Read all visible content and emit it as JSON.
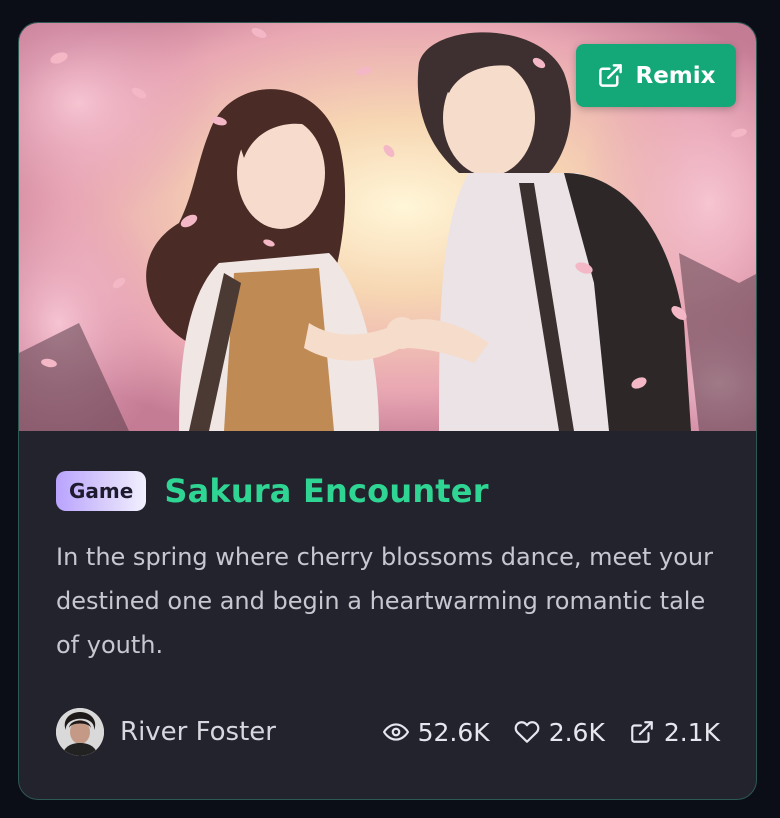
{
  "card": {
    "remix_label": "Remix",
    "tag": "Game",
    "title": "Sakura Encounter",
    "description": "In the spring where cherry blossoms dance, meet your destined one and begin a heartwarming romantic tale of youth.",
    "author": "River Foster",
    "stats": {
      "views": "52.6K",
      "likes": "2.6K",
      "remixes": "2.1K"
    }
  },
  "icons": {
    "remix": "external-link-icon",
    "views": "eye-icon",
    "likes": "heart-icon",
    "remixes": "external-link-icon"
  },
  "colors": {
    "accent": "#14a878",
    "title": "#2fd593",
    "card_bg": "#23232e",
    "page_bg": "#0b0d17",
    "tag_gradient_start": "#b9a3ff"
  }
}
